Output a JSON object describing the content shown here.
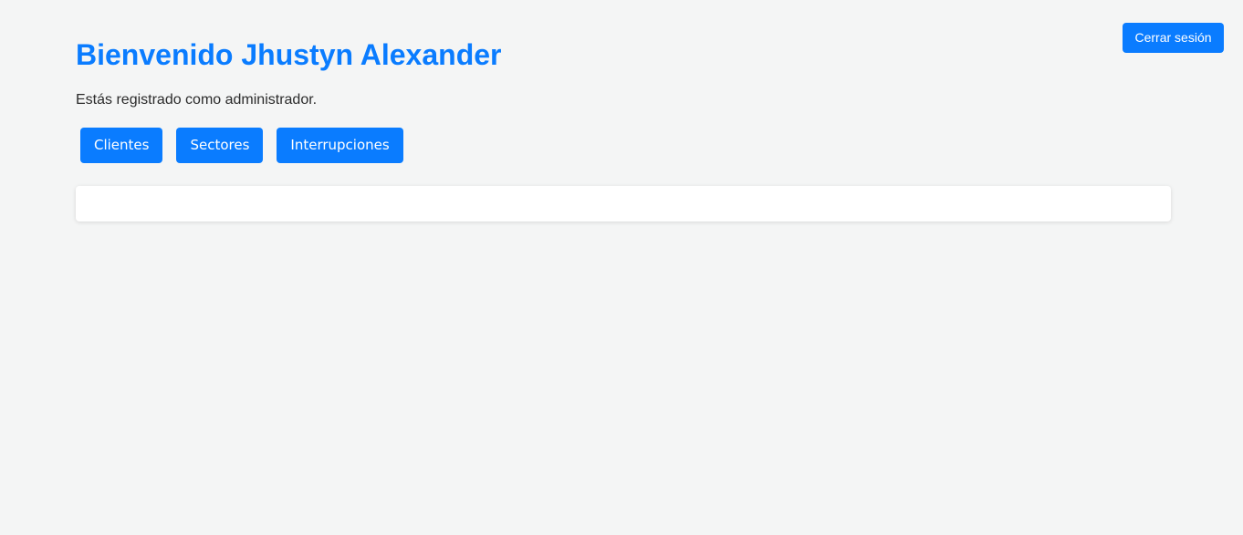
{
  "header": {
    "logout_label": "Cerrar sesión"
  },
  "main": {
    "title": "Bienvenido Jhustyn Alexander",
    "role_text": "Estás registrado como administrador.",
    "nav_buttons": [
      {
        "label": "Clientes"
      },
      {
        "label": "Sectores"
      },
      {
        "label": "Interrupciones"
      }
    ]
  },
  "colors": {
    "accent": "#0a7cff",
    "background": "#f4f5f5",
    "panel": "#ffffff",
    "text": "#2b2b2b"
  }
}
